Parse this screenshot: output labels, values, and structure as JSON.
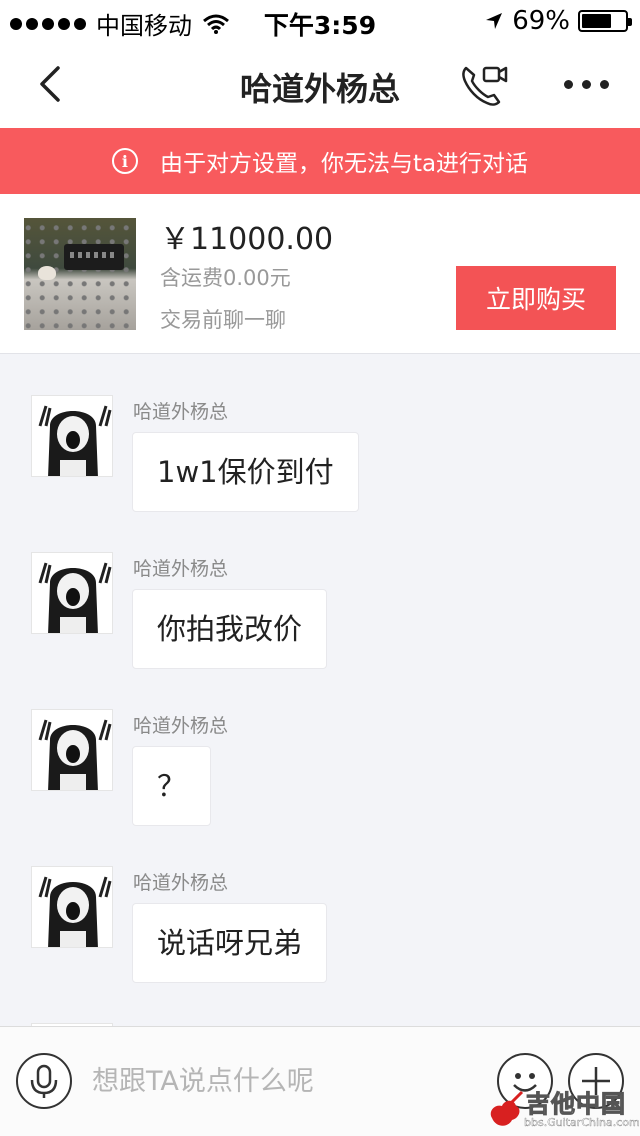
{
  "status_bar": {
    "carrier": "中国移动",
    "time": "下午3:59",
    "battery": "69%",
    "battery_level": 0.69
  },
  "nav": {
    "title": "哈道外杨总"
  },
  "banner": {
    "icon_glyph": "i",
    "text": "由于对方设置，你无法与ta进行对话"
  },
  "product": {
    "price": "￥11000.00",
    "shipping": "含运费0.00元",
    "chat_hint": "交易前聊一聊",
    "buy_label": "立即购买"
  },
  "messages": [
    {
      "sender": "哈道外杨总",
      "text": "1w1保价到付"
    },
    {
      "sender": "哈道外杨总",
      "text": "你拍我改价"
    },
    {
      "sender": "哈道外杨总",
      "text": "？"
    },
    {
      "sender": "哈道外杨总",
      "text": "说话呀兄弟"
    }
  ],
  "input": {
    "placeholder": "想跟TA说点什么呢"
  },
  "watermark": {
    "text": "吉他中国",
    "sub": "bbs.GuitarChina.com"
  },
  "colors": {
    "banner": "#f85a5d",
    "buy_button": "#f35355",
    "chat_bg": "#f3f4f8"
  }
}
